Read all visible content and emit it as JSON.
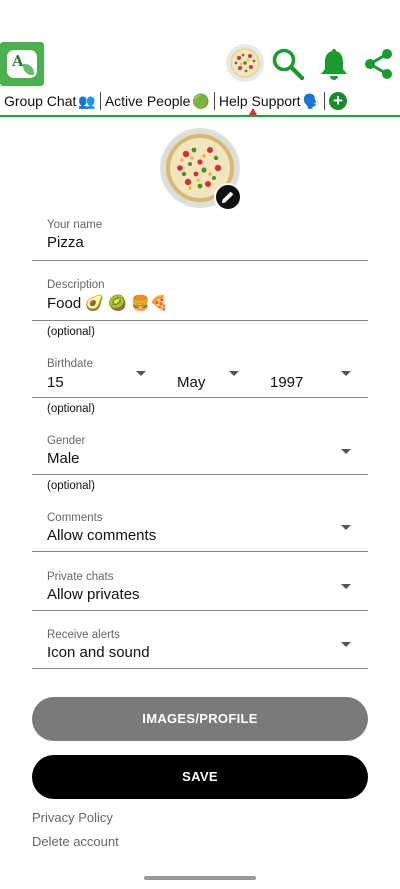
{
  "appbar": {
    "logo_letter": "A",
    "icons": [
      "app-logo",
      "avatar",
      "search-icon",
      "bell-icon",
      "share-icon"
    ],
    "accent_color": "#1b9a2d"
  },
  "tabs": [
    {
      "label": "Group Chat",
      "emoji": "👥"
    },
    {
      "label": "Active People",
      "emoji": "🟢"
    },
    {
      "label": "Help Support",
      "emoji": "🗣️",
      "active": true
    }
  ],
  "form": {
    "name": {
      "label": "Your name",
      "value": "Pizza"
    },
    "description": {
      "label": "Description",
      "value": "Food 🥑 🥝 🍔🍕",
      "hint": "(optional)"
    },
    "birthdate": {
      "label": "Birthdate",
      "day": "15",
      "month": "May",
      "year": "1997",
      "hint": "(optional)"
    },
    "gender": {
      "label": "Gender",
      "value": "Male",
      "hint": "(optional)"
    },
    "comments": {
      "label": "Comments",
      "value": "Allow comments"
    },
    "private_chats": {
      "label": "Private chats",
      "value": "Allow privates"
    },
    "alerts": {
      "label": "Receive alerts",
      "value": "Icon and sound"
    }
  },
  "buttons": {
    "images_profile": "IMAGES/PROFILE",
    "save": "SAVE"
  },
  "links": {
    "privacy": "Privacy Policy",
    "delete": "Delete account"
  }
}
